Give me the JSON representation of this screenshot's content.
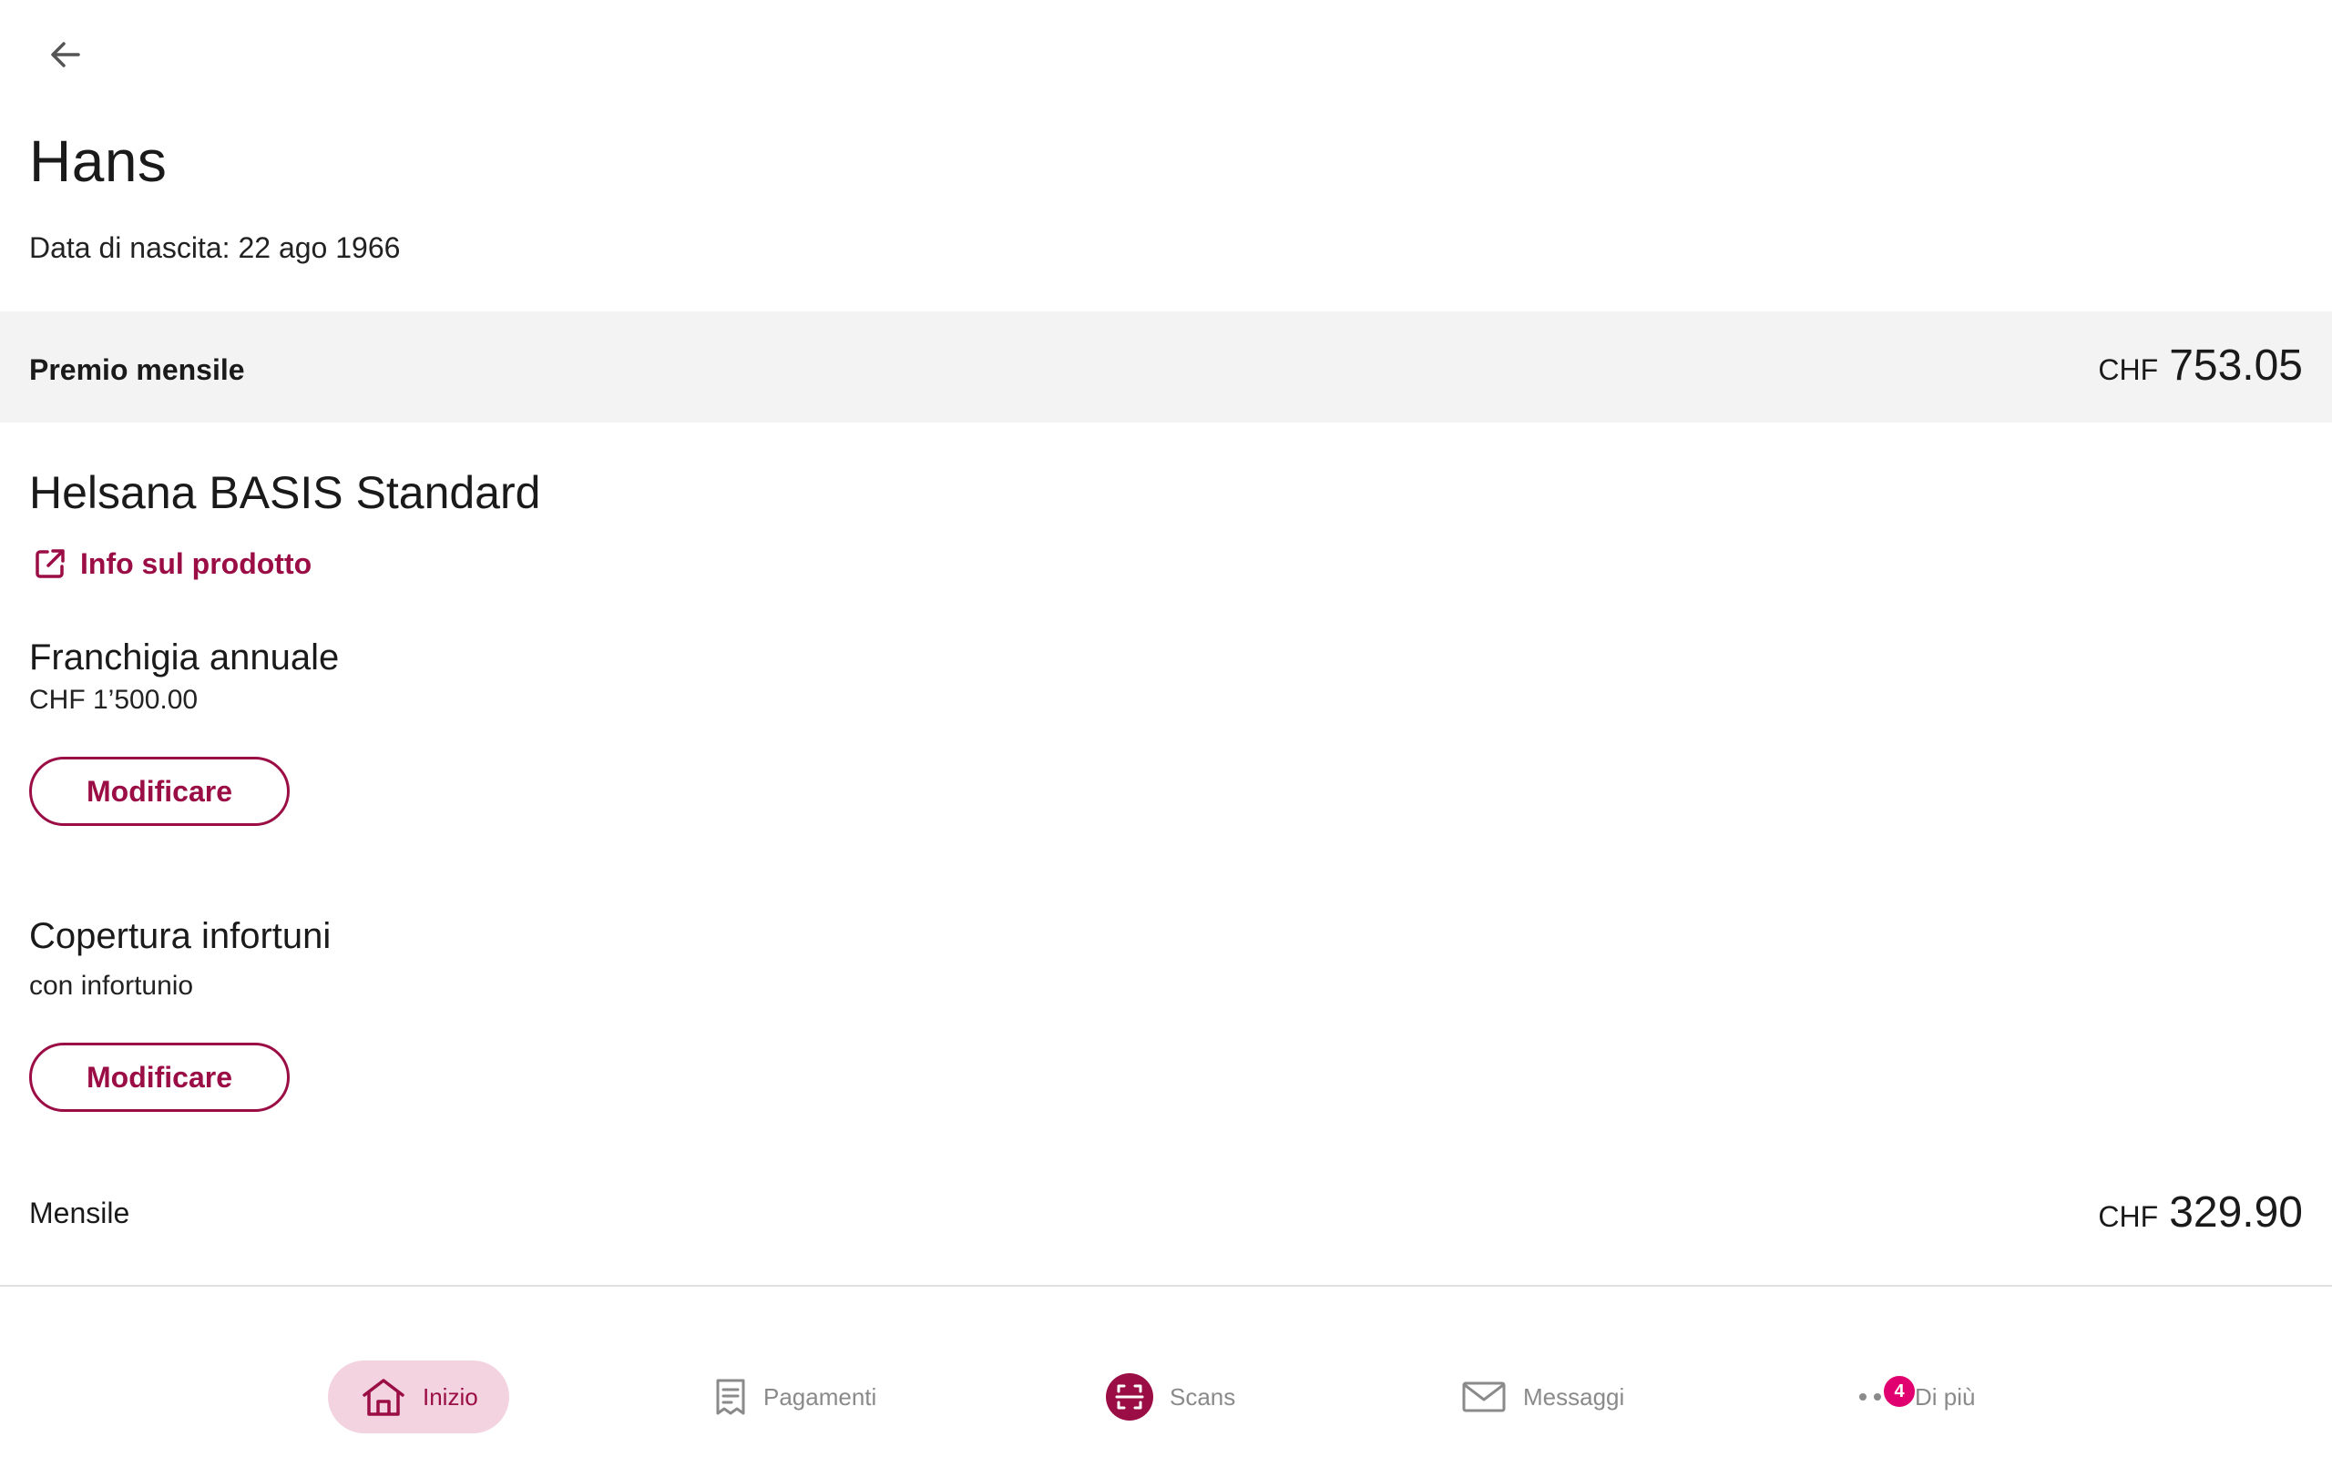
{
  "header": {
    "back_icon": "arrow-left-icon"
  },
  "person": {
    "name": "Hans",
    "birth_label": "Data di nascita:",
    "birth_date": "22 ago 1966"
  },
  "premium": {
    "label": "Premio mensile",
    "currency": "CHF",
    "amount": "753.05"
  },
  "product": {
    "title": "Helsana BASIS Standard",
    "info_link": "Info sul prodotto",
    "info_icon": "external-link-icon"
  },
  "deductible": {
    "title": "Franchigia annuale",
    "value": "CHF 1’500.00",
    "button": "Modificare"
  },
  "accident": {
    "title": "Copertura infortuni",
    "value": "con infortunio",
    "button": "Modificare"
  },
  "monthly": {
    "label": "Mensile",
    "currency": "CHF",
    "amount": "329.90"
  },
  "bottom_nav": {
    "items": [
      {
        "label": "Inizio",
        "icon": "home-icon",
        "active": true
      },
      {
        "label": "Pagamenti",
        "icon": "receipt-icon",
        "active": false
      },
      {
        "label": "Scans",
        "icon": "scan-icon",
        "active": false
      },
      {
        "label": "Messaggi",
        "icon": "envelope-icon",
        "active": false
      },
      {
        "label": "Di più",
        "icon": "more-dots-icon",
        "active": false,
        "badge": "4"
      }
    ]
  },
  "colors": {
    "accent": "#9b0d45",
    "active_nav_bg": "#f2d3df",
    "badge": "#e0006f",
    "band_bg": "#f3f3f3",
    "inactive_nav": "#8a8a8a"
  }
}
